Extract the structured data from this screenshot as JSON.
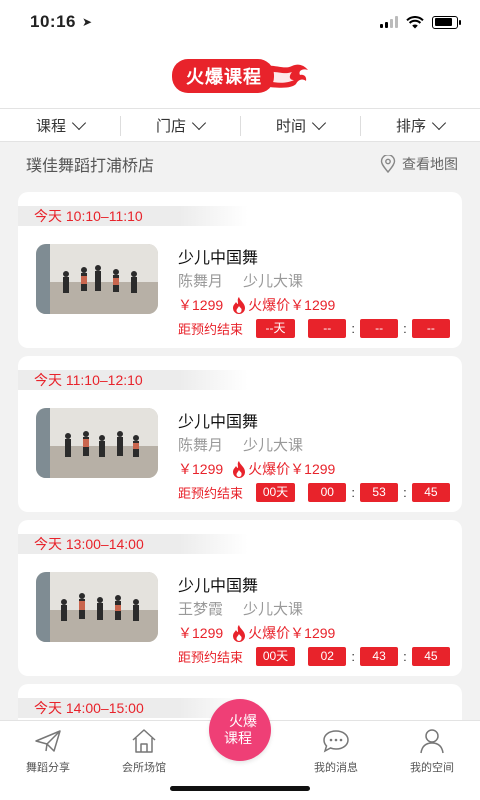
{
  "status": {
    "time": "10:16",
    "battery_level": 0.85
  },
  "header": {
    "logo_text": "火爆课程"
  },
  "filters": [
    {
      "label": "课程"
    },
    {
      "label": "门店"
    },
    {
      "label": "时间"
    },
    {
      "label": "排序"
    }
  ],
  "store": {
    "name": "璞佳舞蹈打浦桥店",
    "map_link": "查看地图"
  },
  "sessions": [
    {
      "time": "今天 10:10–11:10",
      "course": "少儿中国舞",
      "teacher": "陈舞月",
      "type": "少儿大课",
      "price": "￥1299",
      "hot_label": "火爆价",
      "hot_price": "￥1299",
      "countdown_label": "距预约结束",
      "cd_days": "--天",
      "cd_h": "--",
      "cd_m": "--",
      "cd_s": "--"
    },
    {
      "time": "今天 11:10–12:10",
      "course": "少儿中国舞",
      "teacher": "陈舞月",
      "type": "少儿大课",
      "price": "￥1299",
      "hot_label": "火爆价",
      "hot_price": "￥1299",
      "countdown_label": "距预约结束",
      "cd_days": "00天",
      "cd_h": "00",
      "cd_m": "53",
      "cd_s": "45"
    },
    {
      "time": "今天 13:00–14:00",
      "course": "少儿中国舞",
      "teacher": "王梦霞",
      "type": "少儿大课",
      "price": "￥1299",
      "hot_label": "火爆价",
      "hot_price": "￥1299",
      "countdown_label": "距预约结束",
      "cd_days": "00天",
      "cd_h": "02",
      "cd_m": "43",
      "cd_s": "45"
    },
    {
      "time": "今天 14:00–15:00"
    }
  ],
  "tabs": {
    "share": "舞蹈分享",
    "venue": "会所场馆",
    "hot_line1": "火爆",
    "hot_line2": "课程",
    "messages": "我的消息",
    "space": "我的空间"
  },
  "colors": {
    "accent": "#e8232b",
    "hot_button": "#ef3f76"
  }
}
